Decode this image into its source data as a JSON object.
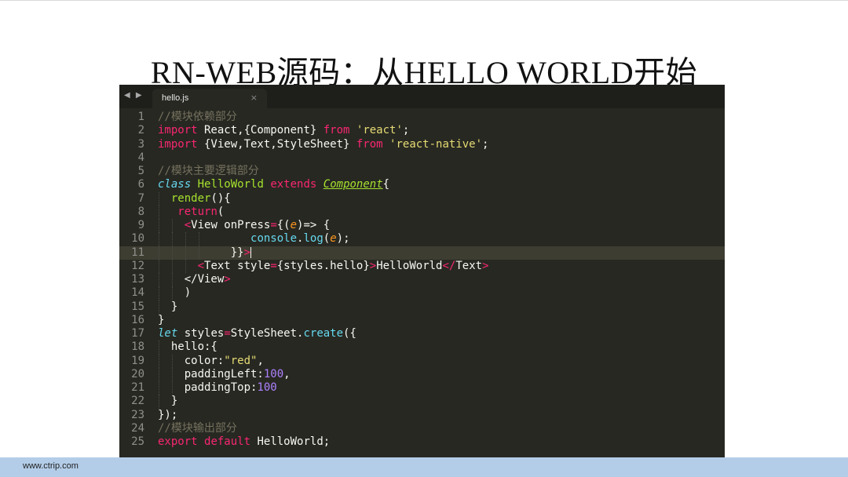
{
  "slide": {
    "title": "RN-WEB源码：从HELLO WORLD开始",
    "footer_url": "www.ctrip.com"
  },
  "editor": {
    "nav_arrows": "◀ ▶",
    "tab": {
      "label": "hello.js",
      "close": "×"
    },
    "active_line": 11,
    "lines": [
      {
        "n": "1",
        "guides": 0,
        "tokens": [
          [
            "comment",
            "//模块依赖部分"
          ]
        ]
      },
      {
        "n": "2",
        "guides": 0,
        "tokens": [
          [
            "keyword",
            "import"
          ],
          [
            "plain",
            " React,{Component} "
          ],
          [
            "keyword",
            "from"
          ],
          [
            "plain",
            " "
          ],
          [
            "string",
            "'react'"
          ],
          [
            "plain",
            ";"
          ]
        ]
      },
      {
        "n": "3",
        "guides": 0,
        "tokens": [
          [
            "keyword",
            "import"
          ],
          [
            "plain",
            " {View,Text,StyleSheet} "
          ],
          [
            "keyword",
            "from"
          ],
          [
            "plain",
            " "
          ],
          [
            "string",
            "'react-native'"
          ],
          [
            "plain",
            ";"
          ]
        ]
      },
      {
        "n": "4",
        "guides": 0,
        "tokens": []
      },
      {
        "n": "5",
        "guides": 0,
        "tokens": [
          [
            "comment",
            "//模块主要逻辑部分"
          ]
        ]
      },
      {
        "n": "6",
        "guides": 0,
        "tokens": [
          [
            "storage",
            "class"
          ],
          [
            "plain",
            " "
          ],
          [
            "class",
            "HelloWorld"
          ],
          [
            "plain",
            " "
          ],
          [
            "storage-plain",
            "extends"
          ],
          [
            "plain",
            " "
          ],
          [
            "inherited",
            "Component"
          ],
          [
            "plain",
            "{"
          ]
        ]
      },
      {
        "n": "7",
        "guides": 1,
        "tokens": [
          [
            "plain",
            "  "
          ],
          [
            "func",
            "render"
          ],
          [
            "plain",
            "(){"
          ]
        ]
      },
      {
        "n": "8",
        "guides": 1,
        "tokens": [
          [
            "plain",
            "   "
          ],
          [
            "keyword",
            "return"
          ],
          [
            "plain",
            "("
          ]
        ]
      },
      {
        "n": "9",
        "guides": 2,
        "tokens": [
          [
            "plain",
            "    "
          ],
          [
            "tag",
            "<"
          ],
          [
            "plain",
            "View onPress"
          ],
          [
            "keyword",
            "="
          ],
          [
            "plain",
            "{("
          ],
          [
            "param",
            "e"
          ],
          [
            "plain",
            ")=> {"
          ]
        ]
      },
      {
        "n": "10",
        "guides": 4,
        "tokens": [
          [
            "plain",
            "              "
          ],
          [
            "support",
            "console"
          ],
          [
            "plain",
            "."
          ],
          [
            "support",
            "log"
          ],
          [
            "plain",
            "("
          ],
          [
            "param",
            "e"
          ],
          [
            "plain",
            ");"
          ]
        ]
      },
      {
        "n": "11",
        "guides": 4,
        "tokens": [
          [
            "plain",
            "           }}"
          ],
          [
            "tag",
            ">"
          ],
          [
            "cursor",
            ""
          ]
        ]
      },
      {
        "n": "12",
        "guides": 3,
        "tokens": [
          [
            "plain",
            "      "
          ],
          [
            "tag",
            "<"
          ],
          [
            "plain",
            "Text style"
          ],
          [
            "keyword",
            "="
          ],
          [
            "plain",
            "{styles.hello}"
          ],
          [
            "tag",
            ">"
          ],
          [
            "plain",
            "HelloWorld"
          ],
          [
            "tag",
            "</"
          ],
          [
            "plain",
            "Text"
          ],
          [
            "tag",
            ">"
          ]
        ]
      },
      {
        "n": "13",
        "guides": 2,
        "tokens": [
          [
            "plain",
            "    </View"
          ],
          [
            "tag",
            ">"
          ]
        ]
      },
      {
        "n": "14",
        "guides": 2,
        "tokens": [
          [
            "plain",
            "    )"
          ]
        ]
      },
      {
        "n": "15",
        "guides": 1,
        "tokens": [
          [
            "plain",
            "  }"
          ]
        ]
      },
      {
        "n": "16",
        "guides": 0,
        "tokens": [
          [
            "plain",
            "}"
          ]
        ]
      },
      {
        "n": "17",
        "guides": 0,
        "tokens": [
          [
            "storage",
            "let"
          ],
          [
            "plain",
            " styles"
          ],
          [
            "keyword",
            "="
          ],
          [
            "plain",
            "StyleSheet."
          ],
          [
            "support",
            "create"
          ],
          [
            "plain",
            "({"
          ]
        ]
      },
      {
        "n": "18",
        "guides": 1,
        "tokens": [
          [
            "plain",
            "  hello:{"
          ]
        ]
      },
      {
        "n": "19",
        "guides": 2,
        "tokens": [
          [
            "plain",
            "    color:"
          ],
          [
            "string",
            "\"red\""
          ],
          [
            "plain",
            ","
          ]
        ]
      },
      {
        "n": "20",
        "guides": 2,
        "tokens": [
          [
            "plain",
            "    paddingLeft:"
          ],
          [
            "number",
            "100"
          ],
          [
            "plain",
            ","
          ]
        ]
      },
      {
        "n": "21",
        "guides": 2,
        "tokens": [
          [
            "plain",
            "    paddingTop:"
          ],
          [
            "number",
            "100"
          ]
        ]
      },
      {
        "n": "22",
        "guides": 1,
        "tokens": [
          [
            "plain",
            "  }"
          ]
        ]
      },
      {
        "n": "23",
        "guides": 0,
        "tokens": [
          [
            "plain",
            "});"
          ]
        ]
      },
      {
        "n": "24",
        "guides": 0,
        "tokens": [
          [
            "comment",
            "//模块输出部分"
          ]
        ]
      },
      {
        "n": "25",
        "guides": 0,
        "tokens": [
          [
            "keyword",
            "export"
          ],
          [
            "plain",
            " "
          ],
          [
            "keyword",
            "default"
          ],
          [
            "plain",
            " HelloWorld;"
          ]
        ]
      }
    ]
  }
}
